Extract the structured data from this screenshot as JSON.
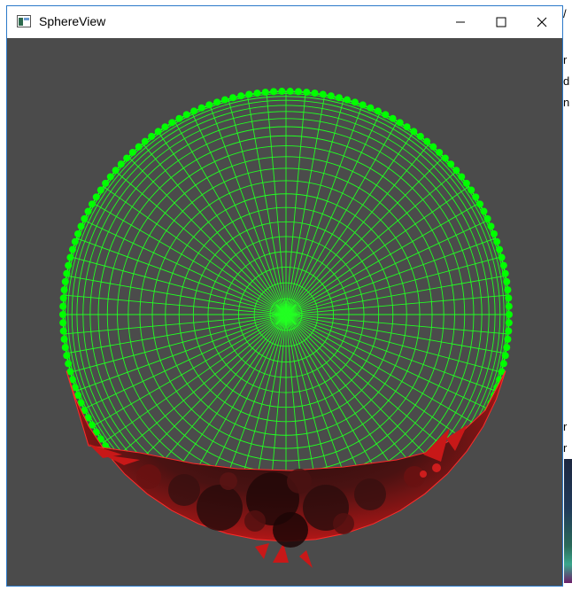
{
  "window": {
    "title": "SphereView",
    "app_icon": "window-app-icon",
    "controls": {
      "minimize_icon": "minimize-icon",
      "maximize_icon": "maximize-icon",
      "close_icon": "close-icon"
    }
  },
  "scene": {
    "background_color": "#4b4b4b",
    "sphere_wire_color": "#22ff22",
    "rim_dot_color": "#00ff00",
    "surface_colors": [
      "#d41818",
      "#8a1010",
      "#3a1010",
      "#ff2a2a"
    ]
  },
  "side_strip": {
    "chars": [
      "/",
      "r",
      "d",
      "n",
      "r",
      "r"
    ]
  }
}
